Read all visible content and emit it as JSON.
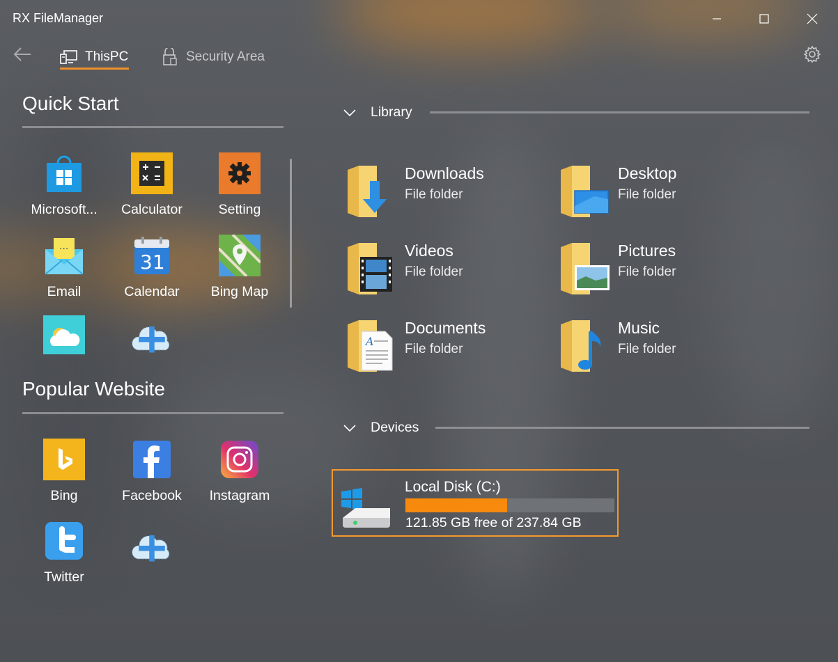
{
  "window": {
    "title": "RX FileManager"
  },
  "nav": {
    "tabs": [
      {
        "label": "ThisPC",
        "icon": "computer-icon",
        "active": true
      },
      {
        "label": "Security Area",
        "icon": "lock-icon",
        "active": false
      }
    ]
  },
  "left": {
    "quick_start": {
      "title": "Quick Start",
      "items": [
        {
          "label": "Microsoft...",
          "icon": "microsoft-store-icon"
        },
        {
          "label": "Calculator",
          "icon": "calculator-icon"
        },
        {
          "label": "Setting",
          "icon": "settings-gear-icon"
        },
        {
          "label": "Email",
          "icon": "email-icon"
        },
        {
          "label": "Calendar",
          "icon": "calendar-icon",
          "day": "31"
        },
        {
          "label": "Bing Map",
          "icon": "map-pin-icon"
        },
        {
          "label": "",
          "icon": "weather-icon"
        },
        {
          "label": "",
          "icon": "add-cloud-icon"
        }
      ]
    },
    "popular_website": {
      "title": "Popular Website",
      "items": [
        {
          "label": "Bing",
          "icon": "bing-icon"
        },
        {
          "label": "Facebook",
          "icon": "facebook-icon"
        },
        {
          "label": "Instagram",
          "icon": "instagram-icon"
        },
        {
          "label": "Twitter",
          "icon": "twitter-icon"
        },
        {
          "label": "",
          "icon": "add-cloud-icon"
        }
      ]
    }
  },
  "library": {
    "title": "Library",
    "folders": [
      {
        "name": "Downloads",
        "type": "File folder",
        "icon": "downloads-folder-icon"
      },
      {
        "name": "Desktop",
        "type": "File folder",
        "icon": "desktop-folder-icon"
      },
      {
        "name": "Videos",
        "type": "File folder",
        "icon": "videos-folder-icon"
      },
      {
        "name": "Pictures",
        "type": "File folder",
        "icon": "pictures-folder-icon"
      },
      {
        "name": "Documents",
        "type": "File folder",
        "icon": "documents-folder-icon"
      },
      {
        "name": "Music",
        "type": "File folder",
        "icon": "music-folder-icon"
      }
    ]
  },
  "devices": {
    "title": "Devices",
    "drives": [
      {
        "name": "Local Disk (C:)",
        "free_text": "121.85 GB free of 237.84 GB",
        "used_fraction": 0.488,
        "icon": "hard-drive-icon"
      }
    ]
  },
  "colors": {
    "accent": "#f0902a",
    "usage_bar": "#f7890d",
    "background": "#4f5257"
  }
}
